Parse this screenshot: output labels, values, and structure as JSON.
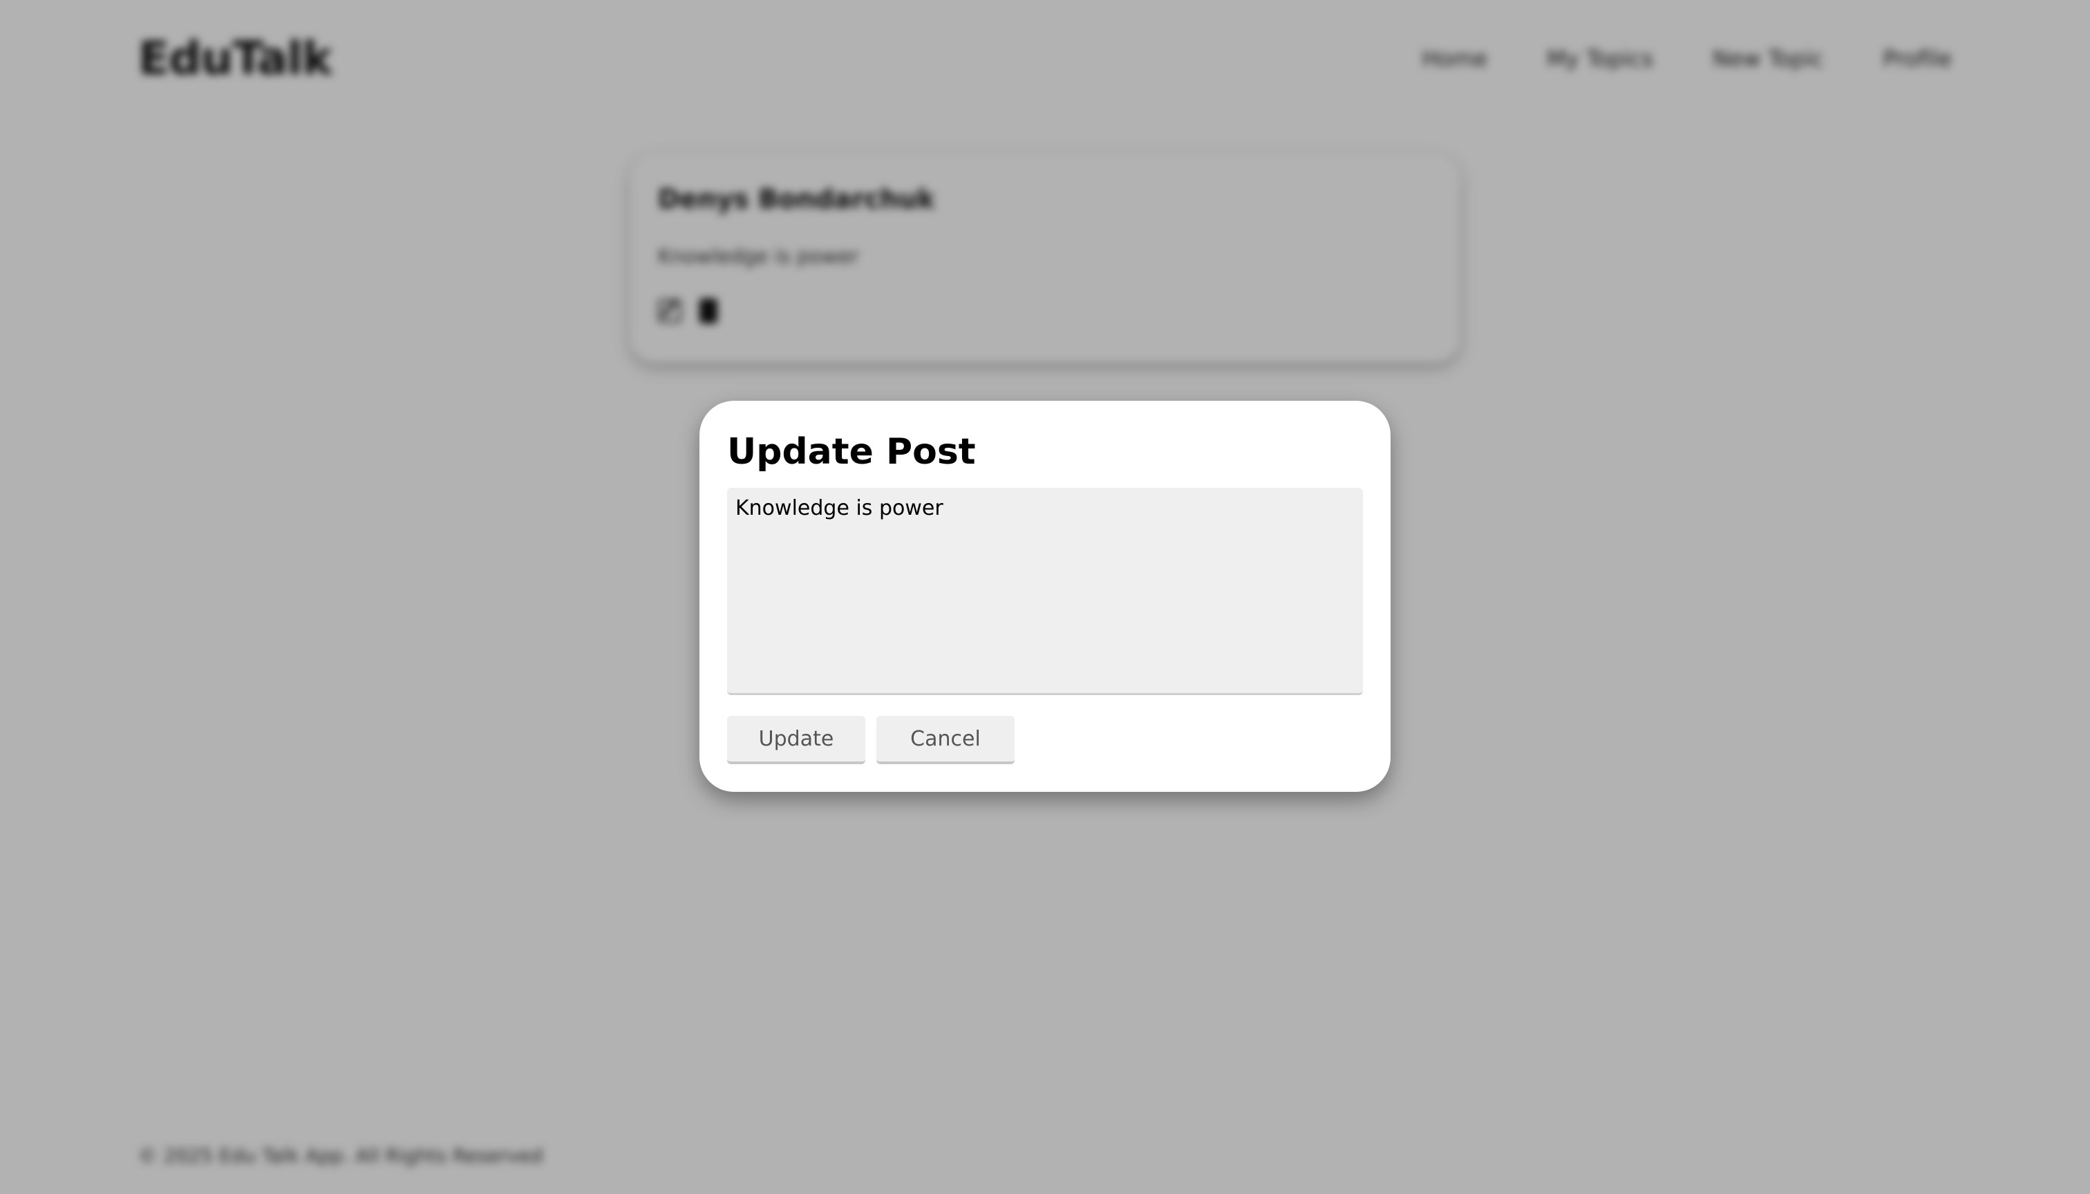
{
  "header": {
    "logo": "EduTalk",
    "nav": [
      "Home",
      "My Topics",
      "New Topic",
      "Profile"
    ]
  },
  "post": {
    "author": "Denys Bondarchuk",
    "body": "Knowledge is power"
  },
  "footer": {
    "text": "© 2025 Edu Talk App. All Rights Reserved"
  },
  "modal": {
    "title": "Update Post",
    "textarea_value": "Knowledge is power",
    "update_label": "Update",
    "cancel_label": "Cancel"
  }
}
